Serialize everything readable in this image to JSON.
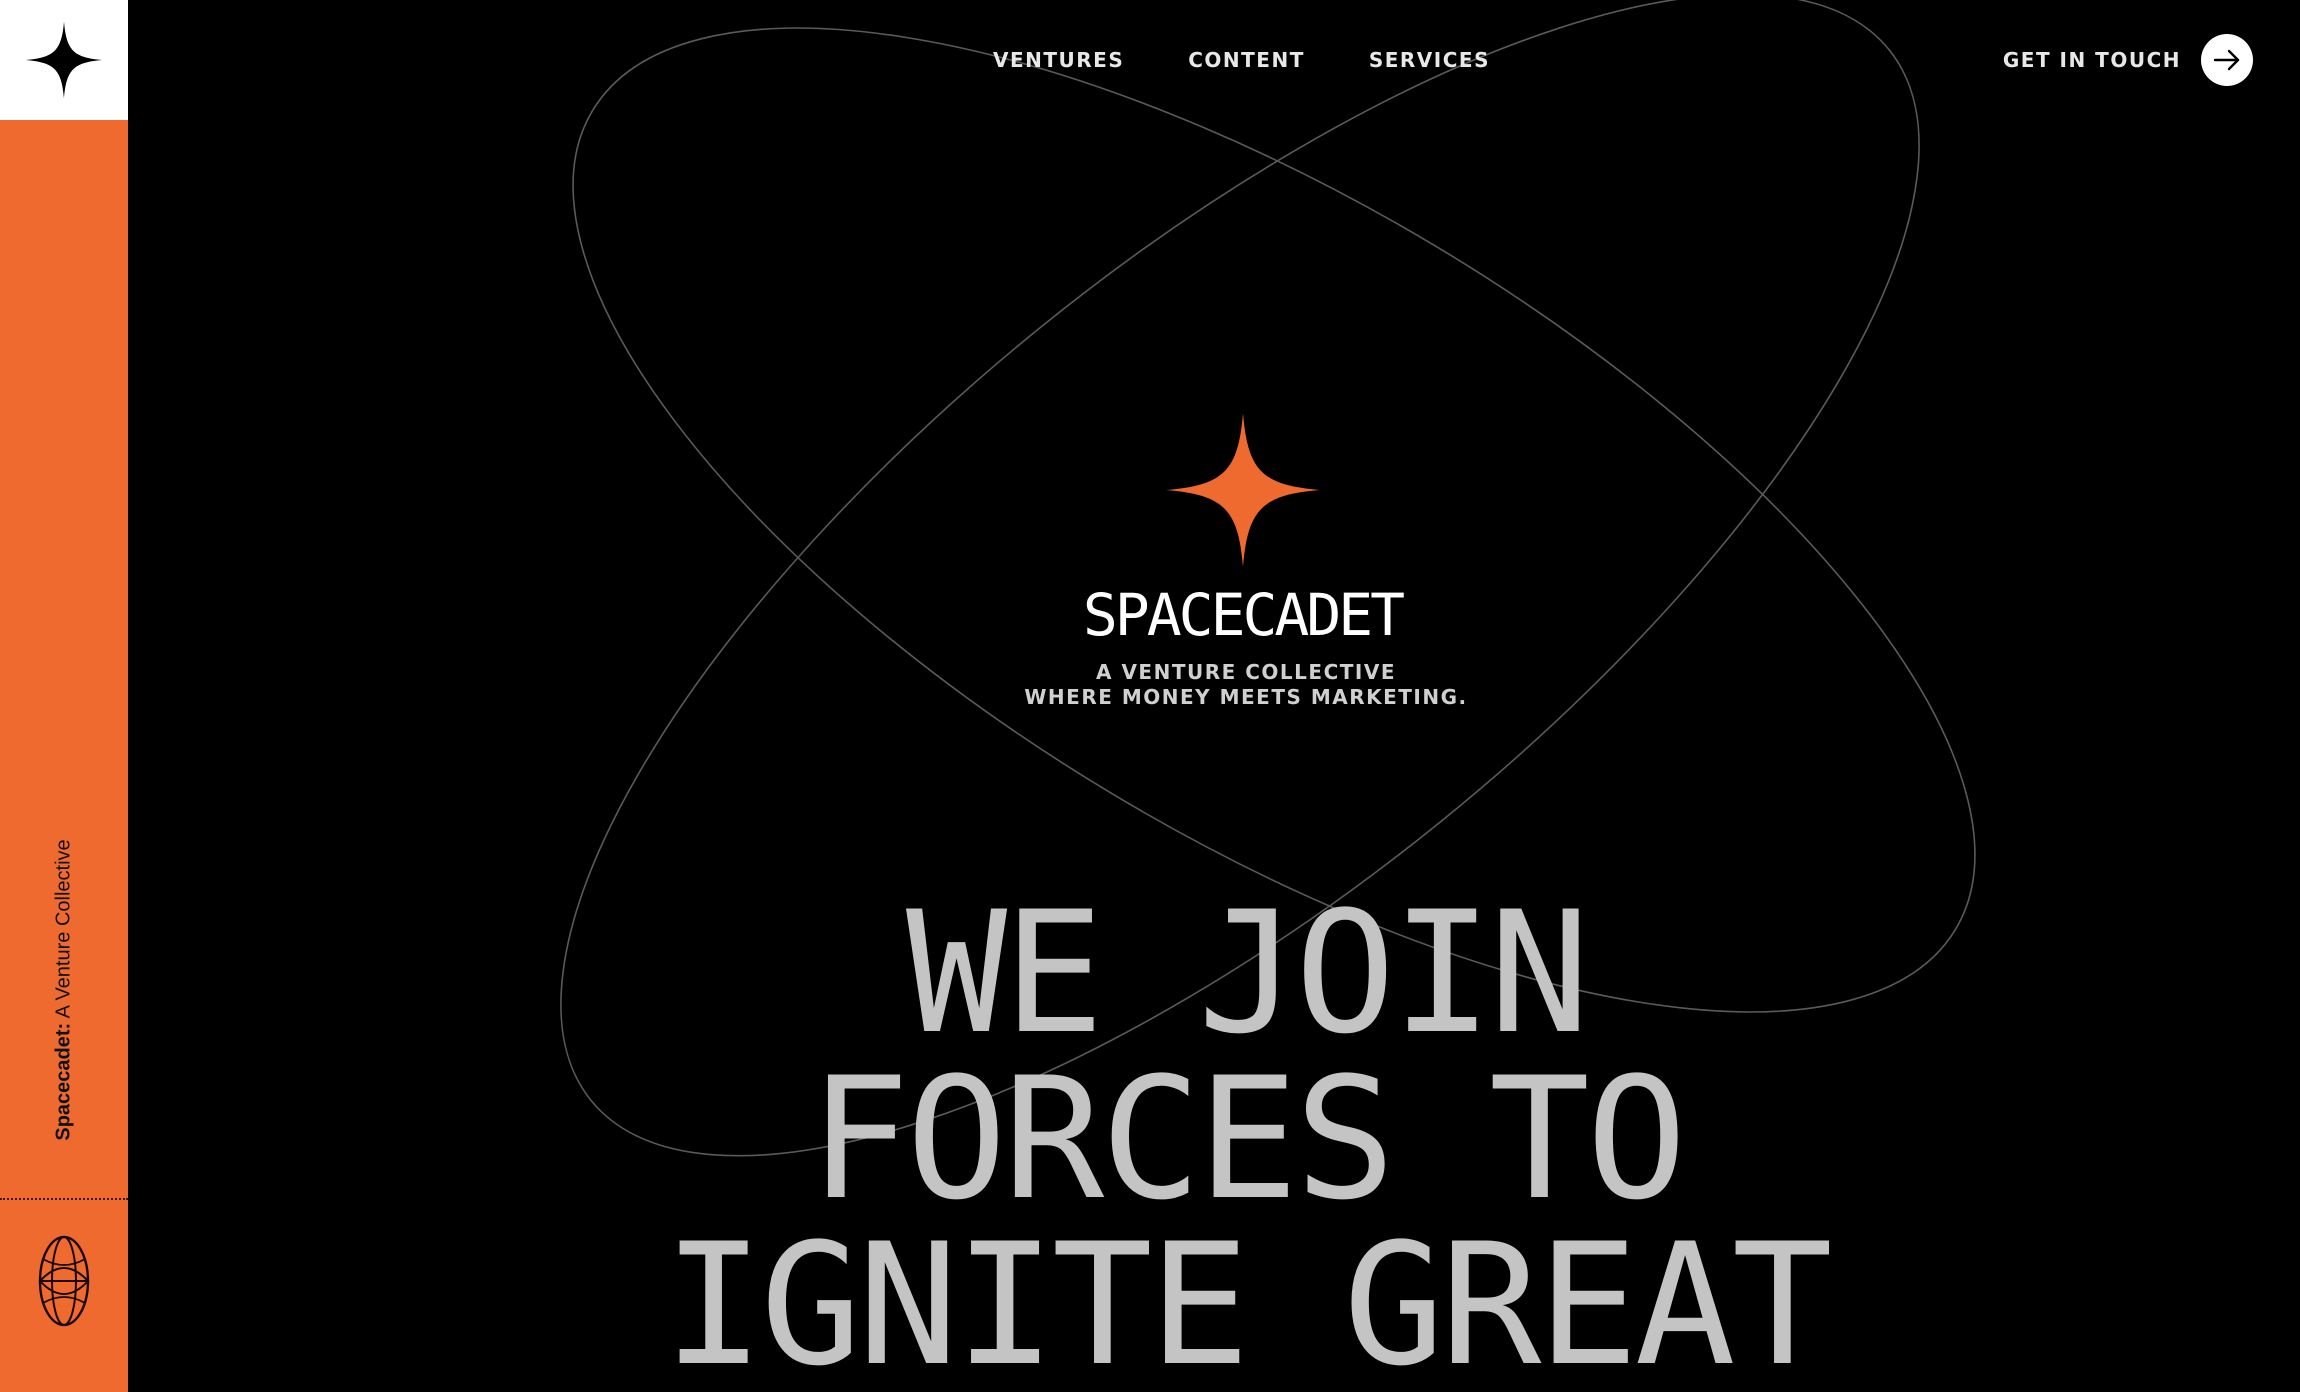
{
  "nav": {
    "items": [
      {
        "label": "VENTURES"
      },
      {
        "label": "CONTENT"
      },
      {
        "label": "SERVICES"
      }
    ],
    "cta_label": "GET IN TOUCH"
  },
  "sidebar": {
    "brand_bold": "Spacecadet:",
    "brand_rest": " A Venture Collective"
  },
  "hero": {
    "brand": "SPACECADET",
    "tagline_line1": "A VENTURE COLLECTIVE",
    "tagline_line2": "WHERE MONEY MEETS MARKETING.",
    "headline_lines": [
      "WE JOIN",
      "FORCES TO",
      "IGNITE GREAT"
    ]
  },
  "colors": {
    "accent": "#EE6A2F",
    "background": "#000000",
    "headline": "#C4C4C4"
  },
  "icons": {
    "logo": "four-point-star-icon",
    "hero": "four-point-star-icon",
    "cta": "arrow-right-icon",
    "footer": "globe-icon"
  }
}
